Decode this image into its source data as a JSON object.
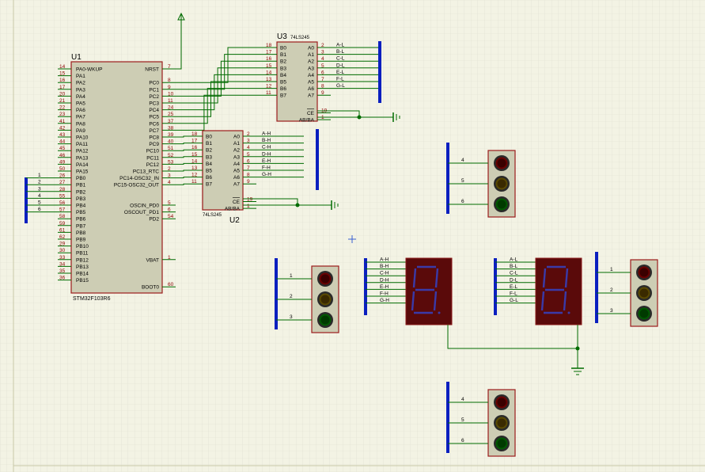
{
  "u1": {
    "ref": "U1",
    "part": "STM32F103R6",
    "left_pins": [
      {
        "num": "14",
        "name": "PA0-WKUP"
      },
      {
        "num": "15",
        "name": "PA1"
      },
      {
        "num": "16",
        "name": "PA2"
      },
      {
        "num": "17",
        "name": "PA3"
      },
      {
        "num": "20",
        "name": "PA4"
      },
      {
        "num": "21",
        "name": "PA5"
      },
      {
        "num": "22",
        "name": "PA6"
      },
      {
        "num": "23",
        "name": "PA7"
      },
      {
        "num": "41",
        "name": "PA8"
      },
      {
        "num": "42",
        "name": "PA9"
      },
      {
        "num": "43",
        "name": "PA10"
      },
      {
        "num": "44",
        "name": "PA11"
      },
      {
        "num": "45",
        "name": "PA12"
      },
      {
        "num": "46",
        "name": "PA13"
      },
      {
        "num": "49",
        "name": "PA14"
      },
      {
        "num": "50",
        "name": "PA15"
      },
      {
        "num": "26",
        "name": "PB0"
      },
      {
        "num": "27",
        "name": "PB1"
      },
      {
        "num": "28",
        "name": "PB2"
      },
      {
        "num": "55",
        "name": "PB3"
      },
      {
        "num": "56",
        "name": "PB4"
      },
      {
        "num": "57",
        "name": "PB5"
      },
      {
        "num": "58",
        "name": "PB6"
      },
      {
        "num": "59",
        "name": "PB7"
      },
      {
        "num": "61",
        "name": "PB8"
      },
      {
        "num": "62",
        "name": "PB9"
      },
      {
        "num": "29",
        "name": "PB10"
      },
      {
        "num": "30",
        "name": "PB11"
      },
      {
        "num": "33",
        "name": "PB12"
      },
      {
        "num": "34",
        "name": "PB13"
      },
      {
        "num": "35",
        "name": "PB14"
      },
      {
        "num": "36",
        "name": "PB15"
      }
    ],
    "right_pins_top": [
      {
        "num": "7",
        "name": "NRST"
      },
      {
        "num": "8",
        "name": "PC0"
      },
      {
        "num": "9",
        "name": "PC1"
      },
      {
        "num": "10",
        "name": "PC2"
      },
      {
        "num": "11",
        "name": "PC3"
      },
      {
        "num": "24",
        "name": "PC4"
      },
      {
        "num": "25",
        "name": "PC5"
      },
      {
        "num": "37",
        "name": "PC6"
      },
      {
        "num": "38",
        "name": "PC7"
      },
      {
        "num": "39",
        "name": "PC8"
      },
      {
        "num": "40",
        "name": "PC9"
      },
      {
        "num": "51",
        "name": "PC10"
      },
      {
        "num": "52",
        "name": "PC11"
      },
      {
        "num": "53",
        "name": "PC12"
      },
      {
        "num": "2",
        "name": "PC13_RTC"
      },
      {
        "num": "3",
        "name": "PC14-OSC32_IN"
      },
      {
        "num": "4",
        "name": "PC15-OSC32_OUT"
      }
    ],
    "right_pins_bottom": [
      {
        "num": "5",
        "name": "OSCIN_PD0"
      },
      {
        "num": "6",
        "name": "OSCOUT_PD1"
      },
      {
        "num": "54",
        "name": "PD2"
      },
      {
        "num": "1",
        "name": "VBAT"
      },
      {
        "num": "60",
        "name": "BOOT0"
      }
    ],
    "bus_labels": [
      "1",
      "2",
      "3",
      "4",
      "5",
      "6"
    ]
  },
  "u3": {
    "ref": "U3",
    "part": "74LS245",
    "left_pins": [
      {
        "num": "18",
        "name": "B0"
      },
      {
        "num": "17",
        "name": "B1"
      },
      {
        "num": "16",
        "name": "B2"
      },
      {
        "num": "15",
        "name": "B3"
      },
      {
        "num": "14",
        "name": "B4"
      },
      {
        "num": "13",
        "name": "B5"
      },
      {
        "num": "12",
        "name": "B6"
      },
      {
        "num": "11",
        "name": "B7"
      }
    ],
    "right_pins": [
      {
        "num": "2",
        "name": "A0",
        "net": "A-L"
      },
      {
        "num": "3",
        "name": "A1",
        "net": "B-L"
      },
      {
        "num": "4",
        "name": "A2",
        "net": "C-L"
      },
      {
        "num": "5",
        "name": "A3",
        "net": "D-L"
      },
      {
        "num": "6",
        "name": "A4",
        "net": "E-L"
      },
      {
        "num": "7",
        "name": "A5",
        "net": "F-L"
      },
      {
        "num": "8",
        "name": "A6",
        "net": "G-L"
      },
      {
        "num": "9",
        "name": "A7",
        "net": ""
      }
    ],
    "ce": {
      "num": "19",
      "name": "CE"
    },
    "dir": {
      "num": "1",
      "name": "AB/BA"
    }
  },
  "u2": {
    "ref": "U2",
    "part": "74LS245",
    "left_pins": [
      {
        "num": "18",
        "name": "B0"
      },
      {
        "num": "17",
        "name": "B1"
      },
      {
        "num": "16",
        "name": "B2"
      },
      {
        "num": "15",
        "name": "B3"
      },
      {
        "num": "14",
        "name": "B4"
      },
      {
        "num": "13",
        "name": "B5"
      },
      {
        "num": "12",
        "name": "B6"
      },
      {
        "num": "11",
        "name": "B7"
      }
    ],
    "right_pins": [
      {
        "num": "2",
        "name": "A0",
        "net": "A-H"
      },
      {
        "num": "3",
        "name": "A1",
        "net": "B-H"
      },
      {
        "num": "4",
        "name": "A2",
        "net": "C-H"
      },
      {
        "num": "5",
        "name": "A3",
        "net": "D-H"
      },
      {
        "num": "6",
        "name": "A4",
        "net": "E-H"
      },
      {
        "num": "7",
        "name": "A5",
        "net": "F-H"
      },
      {
        "num": "8",
        "name": "A6",
        "net": "G-H"
      },
      {
        "num": "9",
        "name": "A7",
        "net": ""
      }
    ],
    "ce": {
      "num": "19",
      "name": "CE"
    },
    "dir": {
      "num": "1",
      "name": "AB/BA"
    }
  },
  "displays": {
    "left_nets": [
      "A-H",
      "B-H",
      "C-H",
      "D-H",
      "E-H",
      "F-H",
      "G-H"
    ],
    "right_nets": [
      "A-L",
      "B-L",
      "C-L",
      "D-L",
      "E-L",
      "F-L",
      "G-L"
    ]
  },
  "traffic_lights": [
    {
      "id": "top-right",
      "pins": [
        "4",
        "5",
        "6"
      ]
    },
    {
      "id": "left",
      "pins": [
        "1",
        "2",
        "3"
      ]
    },
    {
      "id": "right",
      "pins": [
        "1",
        "2",
        "3"
      ]
    },
    {
      "id": "bottom",
      "pins": [
        "4",
        "5",
        "6"
      ]
    }
  ],
  "colors": {
    "background": "#f3f3e4",
    "grid": "#d9d9c8",
    "wire": "#006b00",
    "chip_border": "#9b1c1c",
    "chip_fill": "#cdcdb4",
    "bus": "#0a1fbf",
    "pin_text": "#8b0000",
    "label_text": "#000000",
    "display_body": "#5a0a0a",
    "display_segment": "#3a3aa8",
    "light_red": "#3a0000",
    "light_yellow": "#3a2a00",
    "light_green": "#003a00"
  }
}
